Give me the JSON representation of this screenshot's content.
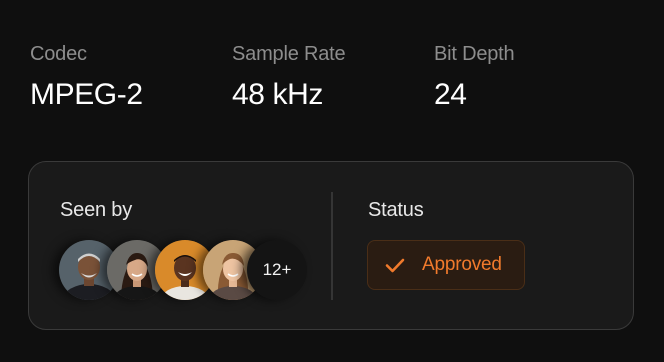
{
  "specs": [
    {
      "label": "Codec",
      "value": "MPEG-2"
    },
    {
      "label": "Sample Rate",
      "value": "48 kHz"
    },
    {
      "label": "Bit Depth",
      "value": "24"
    }
  ],
  "seen_by": {
    "label": "Seen by",
    "avatars": [
      {
        "name": "viewer-1"
      },
      {
        "name": "viewer-2"
      },
      {
        "name": "viewer-3"
      },
      {
        "name": "viewer-4"
      }
    ],
    "more_count": "12+"
  },
  "status": {
    "label": "Status",
    "value": "Approved",
    "icon": "check-icon",
    "color": "#f07a2c"
  }
}
